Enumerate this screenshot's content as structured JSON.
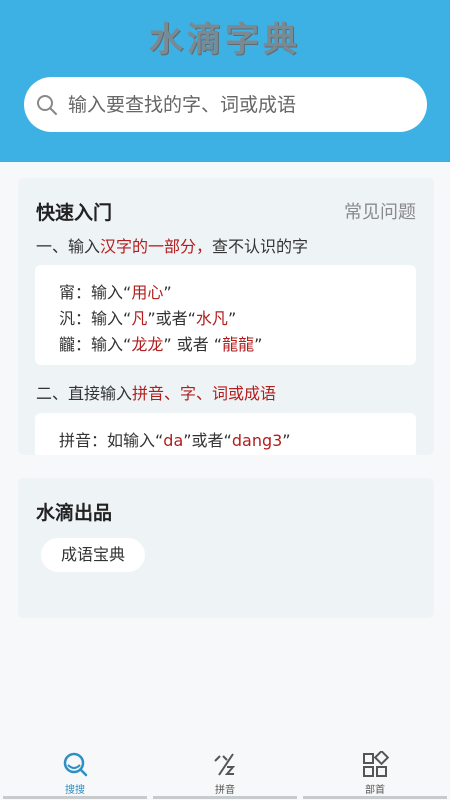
{
  "header": {
    "title": "水滴字典"
  },
  "search": {
    "placeholder": "输入要查找的字、词或成语"
  },
  "quick_start": {
    "title": "快速入门",
    "faq_link": "常见问题",
    "step1": {
      "prefix": "一、输入",
      "highlight": "汉字的一部分，",
      "suffix": "查不认识的字"
    },
    "examples1": [
      {
        "char": "甯",
        "pre": "：输入“",
        "q1": "用心",
        "mid": "”",
        "or": "",
        "q2": "",
        "end": ""
      },
      {
        "char": "汎",
        "pre": "：输入“",
        "q1": "凡",
        "mid": "”或者“",
        "q2": "水凡",
        "end": "”"
      },
      {
        "char": "龖",
        "pre": "：输入“",
        "q1": "龙龙",
        "mid": "” 或者 “",
        "q2": "龍龍",
        "end": "”"
      }
    ],
    "step2": {
      "prefix": "二、直接输入",
      "highlight": "拼音、字、词或成语"
    },
    "example2": {
      "pre": "拼音：如输入“",
      "q1": "da",
      "mid": "”或者“",
      "q2": "dang3",
      "end": "”"
    }
  },
  "products": {
    "title": "水滴出品",
    "item": "成语宝典"
  },
  "tabs": [
    {
      "label": "搜搜",
      "icon": "search-tab-icon",
      "active": true
    },
    {
      "label": "拼音",
      "icon": "pinyin-icon",
      "active": false
    },
    {
      "label": "部首",
      "icon": "radical-grid-icon",
      "active": false
    }
  ],
  "colors": {
    "header": "#3eb1e4",
    "highlight": "#b21d1d",
    "active_tab": "#2d8fc3"
  }
}
